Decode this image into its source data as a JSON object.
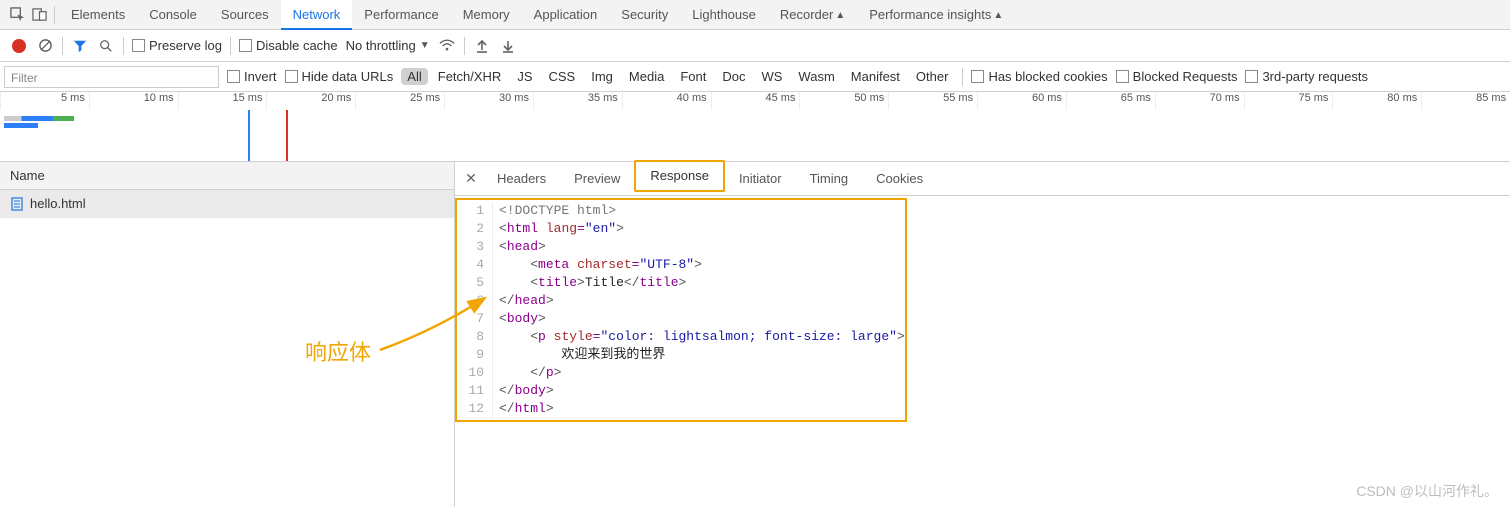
{
  "top_tabs": {
    "inspect_icon": "inspect",
    "device_icon": "device",
    "items": [
      "Elements",
      "Console",
      "Sources",
      "Network",
      "Performance",
      "Memory",
      "Application",
      "Security",
      "Lighthouse",
      "Recorder",
      "Performance insights"
    ],
    "beta_indices": [
      9,
      10
    ],
    "selected_index": 3
  },
  "net_toolbar": {
    "preserve_log": "Preserve log",
    "disable_cache": "Disable cache",
    "throttling": "No throttling"
  },
  "filter_row": {
    "filter_placeholder": "Filter",
    "invert": "Invert",
    "hide_data_urls": "Hide data URLs",
    "types": [
      "All",
      "Fetch/XHR",
      "JS",
      "CSS",
      "Img",
      "Media",
      "Font",
      "Doc",
      "WS",
      "Wasm",
      "Manifest",
      "Other"
    ],
    "type_selected_index": 0,
    "has_blocked_cookies": "Has blocked cookies",
    "blocked_requests": "Blocked Requests",
    "third_party": "3rd-party requests"
  },
  "timeline": {
    "ticks": [
      "5 ms",
      "10 ms",
      "15 ms",
      "20 ms",
      "25 ms",
      "30 ms",
      "35 ms",
      "40 ms",
      "45 ms",
      "50 ms",
      "55 ms",
      "60 ms",
      "65 ms",
      "70 ms",
      "75 ms",
      "80 ms",
      "85 ms"
    ]
  },
  "request_list": {
    "header": "Name",
    "items": [
      {
        "name": "hello.html"
      }
    ]
  },
  "detail_tabs": {
    "items": [
      "Headers",
      "Preview",
      "Response",
      "Initiator",
      "Timing",
      "Cookies"
    ],
    "selected_index": 2
  },
  "response_code": {
    "lines": [
      [
        [
          "dt",
          "<!DOCTYPE html>"
        ]
      ],
      [
        [
          "ang",
          "<"
        ],
        [
          "tag",
          "html"
        ],
        [
          "txt",
          " "
        ],
        [
          "att",
          "lang"
        ],
        [
          "pun",
          "="
        ],
        [
          "str",
          "\"en\""
        ],
        [
          "ang",
          ">"
        ]
      ],
      [
        [
          "ang",
          "<"
        ],
        [
          "tag",
          "head"
        ],
        [
          "ang",
          ">"
        ]
      ],
      [
        [
          "txt",
          "    "
        ],
        [
          "ang",
          "<"
        ],
        [
          "tag",
          "meta"
        ],
        [
          "txt",
          " "
        ],
        [
          "att",
          "charset"
        ],
        [
          "pun",
          "="
        ],
        [
          "str",
          "\"UTF-8\""
        ],
        [
          "ang",
          ">"
        ]
      ],
      [
        [
          "txt",
          "    "
        ],
        [
          "ang",
          "<"
        ],
        [
          "tag",
          "title"
        ],
        [
          "ang",
          ">"
        ],
        [
          "txt",
          "Title"
        ],
        [
          "ang",
          "</"
        ],
        [
          "tag",
          "title"
        ],
        [
          "ang",
          ">"
        ]
      ],
      [
        [
          "ang",
          "</"
        ],
        [
          "tag",
          "head"
        ],
        [
          "ang",
          ">"
        ]
      ],
      [
        [
          "ang",
          "<"
        ],
        [
          "tag",
          "body"
        ],
        [
          "ang",
          ">"
        ]
      ],
      [
        [
          "txt",
          "    "
        ],
        [
          "ang",
          "<"
        ],
        [
          "tag",
          "p"
        ],
        [
          "txt",
          " "
        ],
        [
          "att",
          "style"
        ],
        [
          "pun",
          "="
        ],
        [
          "str",
          "\"color: lightsalmon; font-size: large\""
        ],
        [
          "ang",
          ">"
        ]
      ],
      [
        [
          "txt",
          "        欢迎来到我的世界"
        ]
      ],
      [
        [
          "txt",
          "    "
        ],
        [
          "ang",
          "</"
        ],
        [
          "tag",
          "p"
        ],
        [
          "ang",
          ">"
        ]
      ],
      [
        [
          "ang",
          "</"
        ],
        [
          "tag",
          "body"
        ],
        [
          "ang",
          ">"
        ]
      ],
      [
        [
          "ang",
          "</"
        ],
        [
          "tag",
          "html"
        ],
        [
          "ang",
          ">"
        ]
      ]
    ]
  },
  "annotation": {
    "label": "响应体"
  },
  "watermark": "CSDN @以山河作礼。"
}
